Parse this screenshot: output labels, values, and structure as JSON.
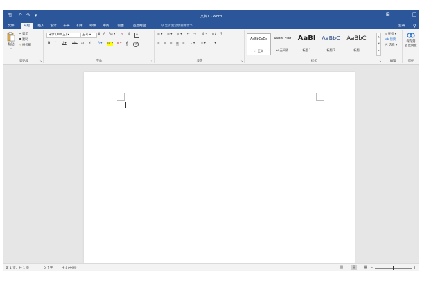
{
  "app": {
    "title": "文档1 - Word",
    "quick_access": {
      "save": "🖫",
      "undo": "↶",
      "redo": "↷",
      "customize": "▾"
    },
    "window_controls": {
      "ribbon_options": "⊞",
      "minimize": "–",
      "maximize": "□"
    }
  },
  "tabs": [
    {
      "label": "文件"
    },
    {
      "label": "开始"
    },
    {
      "label": "插入"
    },
    {
      "label": "设计"
    },
    {
      "label": "布局"
    },
    {
      "label": "引用"
    },
    {
      "label": "邮件"
    },
    {
      "label": "审阅"
    },
    {
      "label": "视图"
    },
    {
      "label": "百度网盘"
    }
  ],
  "active_tab": "开始",
  "tell_me": "♀ 告诉我您想要做什么...",
  "login": "登录",
  "share": "♀",
  "clipboard": {
    "paste": "粘贴",
    "cut": "剪切",
    "copy": "复制",
    "format_painter": "格式刷",
    "label": "剪贴板"
  },
  "font": {
    "font_name": "宋体 (中文正) ▾",
    "font_size": "五号 ▾",
    "grow": "A",
    "shrink": "A",
    "case": "Aa ▾",
    "clear": "✎",
    "phonetic": "文",
    "border": "A",
    "bold": "B",
    "italic": "I",
    "underline": "U ▾",
    "strike": "abc",
    "subscript": "x₂",
    "superscript": "x²",
    "effects": "A ▾",
    "highlight": "ab ▾",
    "color": "A ▾",
    "shade": "A",
    "enclose": "字",
    "label": "字体"
  },
  "paragraph": {
    "bullets": "☰ ▾",
    "numbering": "☰ ▾",
    "multilevel": "☰ ▾",
    "dec_indent": "⇤",
    "inc_indent": "⇥",
    "chinese_layout": "文 ▾",
    "sort": "A↓",
    "show_marks": "¶",
    "align_left": "≡",
    "center": "≡",
    "align_right": "≡",
    "justify": "≡",
    "distribute": "≡",
    "line_spacing": "↕ ▾",
    "shading": "◇ ▾",
    "borders": "□ ▾",
    "label": "段落"
  },
  "styles": {
    "items": [
      {
        "sample": "AaBbCcDd",
        "name": "↵ 正文"
      },
      {
        "sample": "AaBbCcDd",
        "name": "↵ 无间隔"
      },
      {
        "sample": "AaBl",
        "name": "标题 1"
      },
      {
        "sample": "AaBbC",
        "name": "标题 2"
      },
      {
        "sample": "AaBbC",
        "name": "标题"
      }
    ],
    "scroll_up": "▲",
    "scroll_down": "▼",
    "more": "▾",
    "label": "样式"
  },
  "editing": {
    "find": "⌕ 查找 ▾",
    "replace": "ab 替换",
    "select": "⇱ 选择 ▾",
    "label": "编辑"
  },
  "save_group": {
    "button_line1": "保存到",
    "button_line2": "百度网盘",
    "label": "保存"
  },
  "status": {
    "page": "第 1 页，共 1 页",
    "words": "0 个字",
    "language": "中文(中国)"
  },
  "views": {
    "read": "▥",
    "print": "▤",
    "web": "▦"
  },
  "zoom": {
    "minus": "–",
    "plus": "+"
  },
  "colors": {
    "brand": "#2b579a",
    "ribbon": "#f3f3f3",
    "canvas": "#e6e6e6"
  }
}
